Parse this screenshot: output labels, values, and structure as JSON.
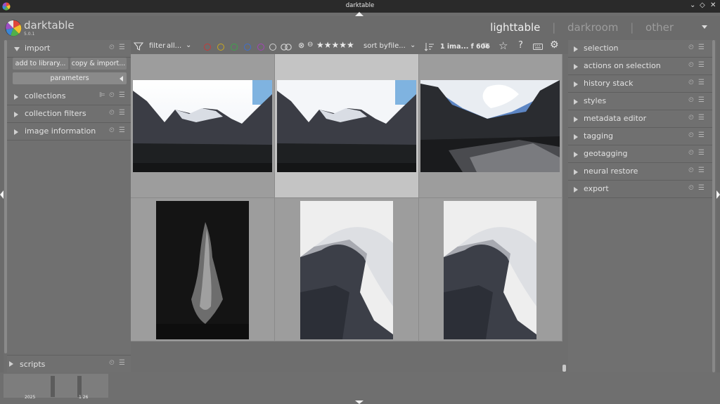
{
  "window": {
    "title": "darktable",
    "minimize_glyph": "⌄",
    "maximize_glyph": "◇",
    "close_glyph": "✕"
  },
  "app": {
    "name": "darktable",
    "version": "5.0.1"
  },
  "views": {
    "active": "lighttable",
    "items": [
      "lighttable",
      "darkroom",
      "other"
    ],
    "separator": "|"
  },
  "left_panel": {
    "import": {
      "label": "import",
      "add_button": "add to library...",
      "copy_button": "copy & import...",
      "parameters_label": "parameters"
    },
    "modules": [
      {
        "label": "collections"
      },
      {
        "label": "collection filters"
      },
      {
        "label": "image information"
      }
    ],
    "scripts_label": "scripts"
  },
  "toolbar": {
    "filter_label": "filter",
    "filter_value": "all...",
    "sort_label": "sort by",
    "sort_value": "file...",
    "count_text": "1 ima... f 606",
    "rating_stars": "★★★★★",
    "help_glyph": "?",
    "color_labels": [
      "#c63a3a",
      "#c9a71f",
      "#3da64a",
      "#3f6fcf",
      "#a543b8"
    ]
  },
  "right_panel": {
    "modules": [
      {
        "label": "selection"
      },
      {
        "label": "actions on selection"
      },
      {
        "label": "history stack"
      },
      {
        "label": "styles"
      },
      {
        "label": "metadata editor"
      },
      {
        "label": "tagging"
      },
      {
        "label": "geotagging"
      },
      {
        "label": "neural restore"
      },
      {
        "label": "export"
      }
    ]
  },
  "timeline": {
    "year_label": "2025",
    "month_label": "1 26"
  }
}
